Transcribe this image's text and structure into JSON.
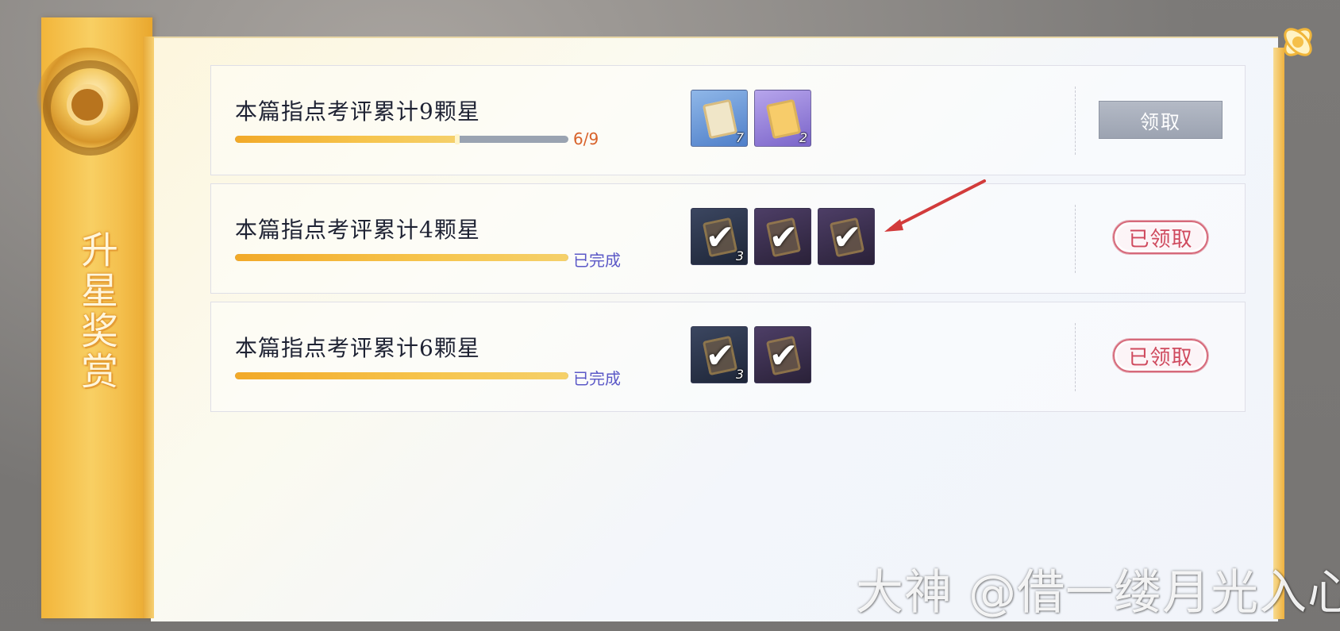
{
  "banner": {
    "title": "升星奖赏"
  },
  "rows": [
    {
      "title": "本篇指点考评累计9颗星",
      "progress": {
        "current": 6,
        "total": 9,
        "fraction": 0.667,
        "label": "6/9"
      },
      "rewards": [
        {
          "icon": "scroll-item-icon",
          "count": "7",
          "claimed": false
        },
        {
          "icon": "ticket-item-icon",
          "count": "2",
          "claimed": false
        }
      ],
      "action": {
        "type": "button",
        "label": "领取"
      }
    },
    {
      "title": "本篇指点考评累计4颗星",
      "progress": {
        "fraction": 1.0,
        "label": "已完成"
      },
      "rewards": [
        {
          "icon": "claimed-item-icon",
          "count": "3",
          "claimed": true
        },
        {
          "icon": "claimed-item-icon",
          "count": "",
          "claimed": true
        },
        {
          "icon": "claimed-item-icon",
          "count": "",
          "claimed": true
        }
      ],
      "action": {
        "type": "stamp",
        "label": "已领取"
      }
    },
    {
      "title": "本篇指点考评累计6颗星",
      "progress": {
        "fraction": 1.0,
        "label": "已完成"
      },
      "rewards": [
        {
          "icon": "claimed-item-icon",
          "count": "3",
          "claimed": true
        },
        {
          "icon": "claimed-item-icon",
          "count": "",
          "claimed": true
        }
      ],
      "action": {
        "type": "stamp",
        "label": "已领取"
      }
    }
  ],
  "colors": {
    "progress_fill": "#f2a928",
    "progress_count": "#d8622a",
    "completed_text": "#5b58c7",
    "stamp": "#cf4a5e",
    "arrow": "#d23b3b"
  },
  "watermark": "大神 @借一缕月光入心"
}
